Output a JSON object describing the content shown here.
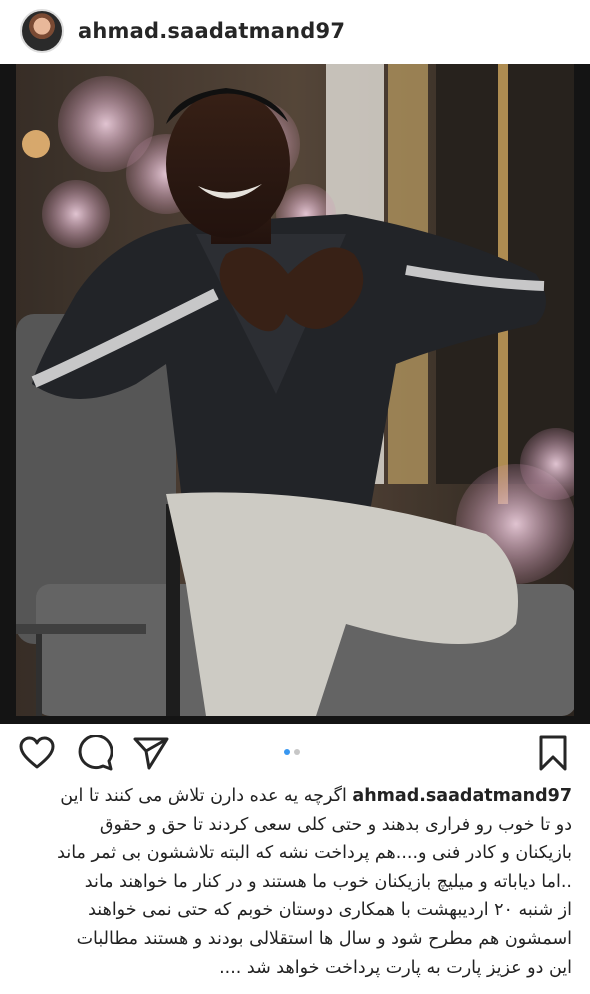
{
  "post": {
    "username": "ahmad.saadatmand97"
  },
  "photo": {
    "subject": "smiling man making a heart shape with his hands, seated in a gray armchair with flowers in the background"
  },
  "actions": {
    "like_icon": "heart-outline-icon",
    "comment_icon": "speech-bubble-icon",
    "share_icon": "paper-plane-icon",
    "save_icon": "bookmark-icon",
    "carousel": {
      "count": 2,
      "active": 1
    }
  },
  "caption": {
    "username": "ahmad.saadatmand97",
    "lines": [
      "اگرچه یه عده دارن تلاش می کنند تا این",
      "دو تا خوب رو فراری بدهند و حتی کلی سعی کردند تا حق و حقوق",
      "بازیکنان و کادر فنی و....هم پرداخت نشه که البته تلاششون بی ثمر ماند",
      "..اما دیاباته و میلیچ بازیکنان خوب ما هستند و در کنار ما خواهند ماند",
      "از شنبه ۲۰ اردیبهشت  با همکاری دوستان خوبم که حتی نمی خواهند",
      "اسمشون هم مطرح شود و سال ها استقلالی بودند و هستند مطالبات",
      "این دو عزیز پارت به پارت پرداخت خواهد شد ...."
    ]
  },
  "colors": {
    "text": "#262626",
    "accent_blue": "#3897f0",
    "inactive_dot": "#c7c7c7"
  }
}
